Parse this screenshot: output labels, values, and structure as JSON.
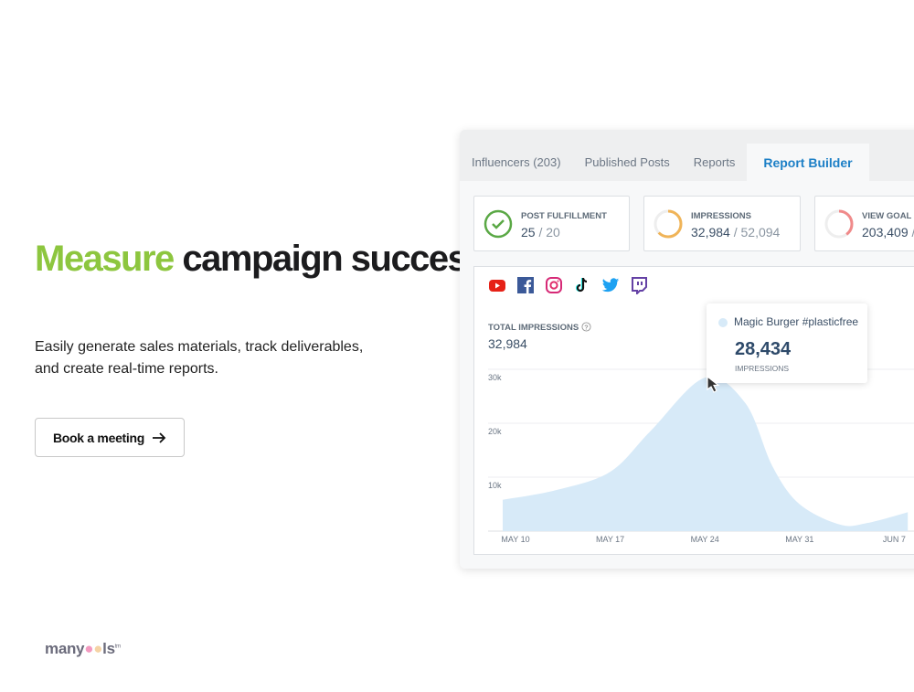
{
  "hero": {
    "title_accent": "Measure",
    "title_rest": " campaign success",
    "subtitle": "Easily generate sales materials, track deliverables, and create real-time reports.",
    "cta_label": "Book a meeting",
    "cta_icon": "arrow-right-icon"
  },
  "logo": {
    "text": "manytools",
    "tm": "tm"
  },
  "tabs": [
    {
      "label": "Influencers (203)"
    },
    {
      "label": "Published Posts"
    },
    {
      "label": "Reports"
    },
    {
      "label": "Report Builder",
      "active": true
    }
  ],
  "cards": [
    {
      "label": "POST FULFILLMENT",
      "value": "25",
      "total": " / 20",
      "icon": "check-circle-icon",
      "color": "#5aa845",
      "progress": 1
    },
    {
      "label": "IMPRESSIONS",
      "value": "32,984",
      "total": " / 52,094",
      "icon": "progress-ring-icon",
      "color": "#f0b458",
      "progress": 0.63
    },
    {
      "label": "VIEW GOAL",
      "value": "203,409",
      "total": " /",
      "icon": "progress-ring-icon",
      "color": "#f08a8a",
      "progress": 0.4
    }
  ],
  "social_icons": [
    "youtube-icon",
    "facebook-icon",
    "instagram-icon",
    "tiktok-icon",
    "twitter-icon",
    "twitch-icon"
  ],
  "total": {
    "label": "TOTAL IMPRESSIONS",
    "value": "32,984",
    "help_icon": "question-circle-icon"
  },
  "tooltip": {
    "name": "Magic Burger #plasticfree",
    "value": "28,434",
    "caption": "IMPRESSIONS",
    "color": "#d7eaf8"
  },
  "chart_data": {
    "type": "area",
    "x_ticks": [
      "MAY 10",
      "MAY 17",
      "MAY 24",
      "MAY 31",
      "JUN 7"
    ],
    "y_ticks": [
      "10k",
      "20k",
      "30k"
    ],
    "ylim": [
      0,
      30000
    ],
    "grid": true,
    "fill_color": "#d7eaf8",
    "points": [
      {
        "x": "May 9",
        "y": 5800
      },
      {
        "x": "May 13",
        "y": 7600
      },
      {
        "x": "May 17",
        "y": 11000
      },
      {
        "x": "May 20",
        "y": 18600
      },
      {
        "x": "May 24",
        "y": 28434
      },
      {
        "x": "May 27",
        "y": 23700
      },
      {
        "x": "May 29",
        "y": 12000
      },
      {
        "x": "May 31",
        "y": 5000
      },
      {
        "x": "Jun 3",
        "y": 1200
      },
      {
        "x": "Jun 5",
        "y": 1500
      },
      {
        "x": "Jun 8",
        "y": 3500
      }
    ]
  }
}
